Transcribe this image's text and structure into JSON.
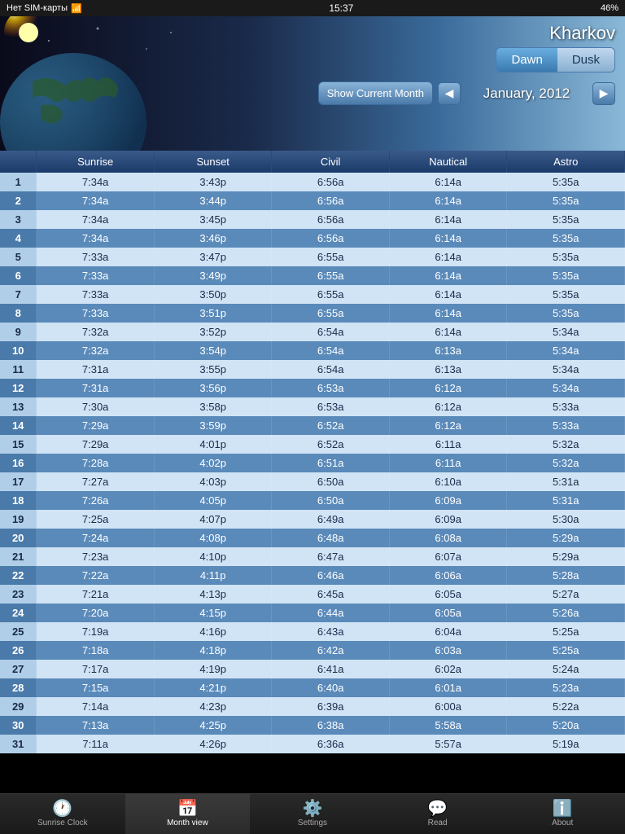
{
  "statusBar": {
    "carrier": "Нет SIM-карты",
    "time": "15:37",
    "battery": "46%"
  },
  "header": {
    "cityName": "Kharkov",
    "dawnLabel": "Dawn",
    "duskLabel": "Dusk",
    "activeDusk": false,
    "showCurrentMonthLabel": "Show Current Month",
    "monthLabel": "January, 2012"
  },
  "table": {
    "columns": [
      "",
      "Sunrise",
      "Sunset",
      "Civil",
      "Nautical",
      "Astro"
    ],
    "rows": [
      [
        1,
        "7:34a",
        "3:43p",
        "6:56a",
        "6:14a",
        "5:35a"
      ],
      [
        2,
        "7:34a",
        "3:44p",
        "6:56a",
        "6:14a",
        "5:35a"
      ],
      [
        3,
        "7:34a",
        "3:45p",
        "6:56a",
        "6:14a",
        "5:35a"
      ],
      [
        4,
        "7:34a",
        "3:46p",
        "6:56a",
        "6:14a",
        "5:35a"
      ],
      [
        5,
        "7:33a",
        "3:47p",
        "6:55a",
        "6:14a",
        "5:35a"
      ],
      [
        6,
        "7:33a",
        "3:49p",
        "6:55a",
        "6:14a",
        "5:35a"
      ],
      [
        7,
        "7:33a",
        "3:50p",
        "6:55a",
        "6:14a",
        "5:35a"
      ],
      [
        8,
        "7:33a",
        "3:51p",
        "6:55a",
        "6:14a",
        "5:35a"
      ],
      [
        9,
        "7:32a",
        "3:52p",
        "6:54a",
        "6:14a",
        "5:34a"
      ],
      [
        10,
        "7:32a",
        "3:54p",
        "6:54a",
        "6:13a",
        "5:34a"
      ],
      [
        11,
        "7:31a",
        "3:55p",
        "6:54a",
        "6:13a",
        "5:34a"
      ],
      [
        12,
        "7:31a",
        "3:56p",
        "6:53a",
        "6:12a",
        "5:34a"
      ],
      [
        13,
        "7:30a",
        "3:58p",
        "6:53a",
        "6:12a",
        "5:33a"
      ],
      [
        14,
        "7:29a",
        "3:59p",
        "6:52a",
        "6:12a",
        "5:33a"
      ],
      [
        15,
        "7:29a",
        "4:01p",
        "6:52a",
        "6:11a",
        "5:32a"
      ],
      [
        16,
        "7:28a",
        "4:02p",
        "6:51a",
        "6:11a",
        "5:32a"
      ],
      [
        17,
        "7:27a",
        "4:03p",
        "6:50a",
        "6:10a",
        "5:31a"
      ],
      [
        18,
        "7:26a",
        "4:05p",
        "6:50a",
        "6:09a",
        "5:31a"
      ],
      [
        19,
        "7:25a",
        "4:07p",
        "6:49a",
        "6:09a",
        "5:30a"
      ],
      [
        20,
        "7:24a",
        "4:08p",
        "6:48a",
        "6:08a",
        "5:29a"
      ],
      [
        21,
        "7:23a",
        "4:10p",
        "6:47a",
        "6:07a",
        "5:29a"
      ],
      [
        22,
        "7:22a",
        "4:11p",
        "6:46a",
        "6:06a",
        "5:28a"
      ],
      [
        23,
        "7:21a",
        "4:13p",
        "6:45a",
        "6:05a",
        "5:27a"
      ],
      [
        24,
        "7:20a",
        "4:15p",
        "6:44a",
        "6:05a",
        "5:26a"
      ],
      [
        25,
        "7:19a",
        "4:16p",
        "6:43a",
        "6:04a",
        "5:25a"
      ],
      [
        26,
        "7:18a",
        "4:18p",
        "6:42a",
        "6:03a",
        "5:25a"
      ],
      [
        27,
        "7:17a",
        "4:19p",
        "6:41a",
        "6:02a",
        "5:24a"
      ],
      [
        28,
        "7:15a",
        "4:21p",
        "6:40a",
        "6:01a",
        "5:23a"
      ],
      [
        29,
        "7:14a",
        "4:23p",
        "6:39a",
        "6:00a",
        "5:22a"
      ],
      [
        30,
        "7:13a",
        "4:25p",
        "6:38a",
        "5:58a",
        "5:20a"
      ],
      [
        31,
        "7:11a",
        "4:26p",
        "6:36a",
        "5:57a",
        "5:19a"
      ]
    ]
  },
  "tabs": [
    {
      "id": "sunrise-clock",
      "label": "Sunrise Clock",
      "icon": "🕐",
      "active": false
    },
    {
      "id": "month-view",
      "label": "Month view",
      "icon": "📅",
      "active": true
    },
    {
      "id": "settings",
      "label": "Settings",
      "icon": "⚙️",
      "active": false
    },
    {
      "id": "read",
      "label": "Read",
      "icon": "💬",
      "active": false
    },
    {
      "id": "about",
      "label": "About",
      "icon": "ℹ️",
      "active": false
    }
  ]
}
